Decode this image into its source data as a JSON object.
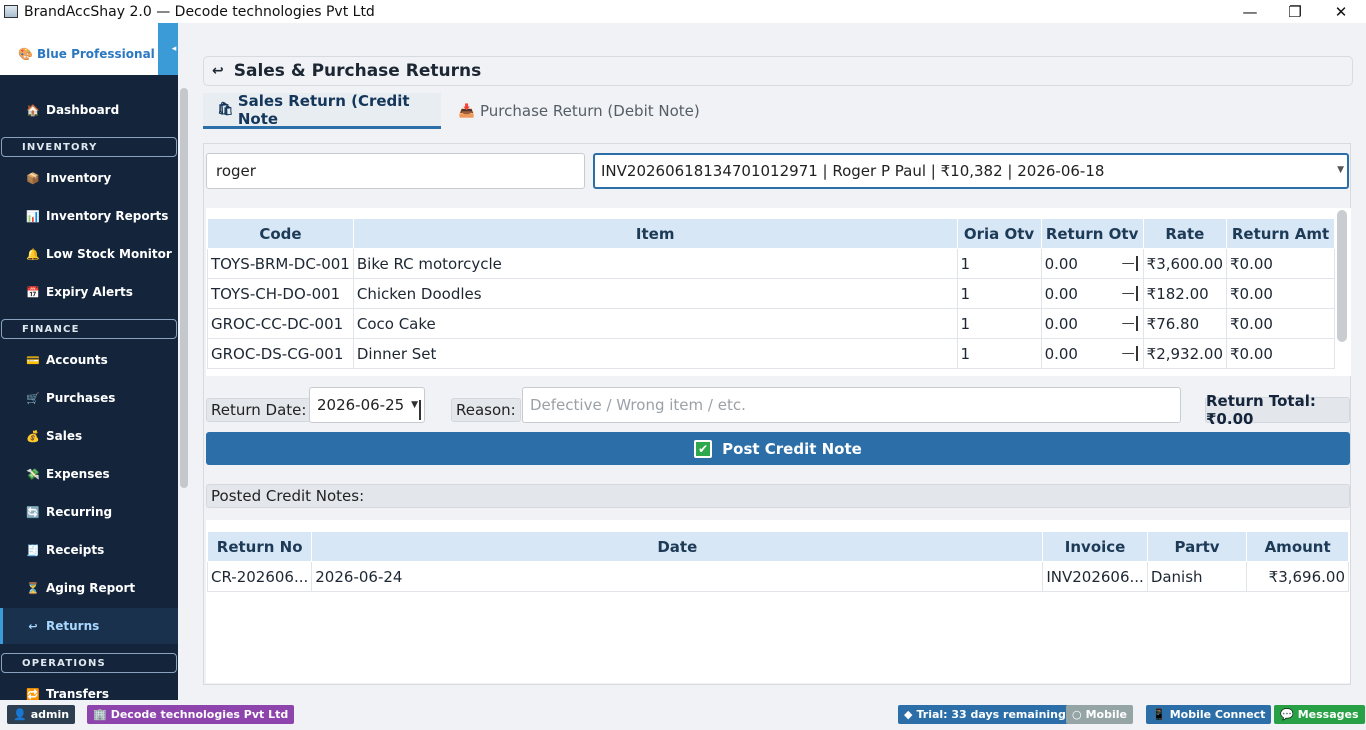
{
  "window": {
    "title": "BrandAccShay 2.0  —  Decode technologies Pvt Ltd",
    "minimize": "—",
    "restore": "❐",
    "close": "✕"
  },
  "sidebar": {
    "brand": "Blue Professional",
    "collapse": "◂",
    "items": [
      {
        "label": "Dashboard",
        "icon": "🏠"
      },
      {
        "section": "INVENTORY"
      },
      {
        "label": "Inventory",
        "icon": "📦"
      },
      {
        "label": "Inventory Reports",
        "icon": "📊"
      },
      {
        "label": "Low Stock Monitor",
        "icon": "🔔"
      },
      {
        "label": "Expiry Alerts",
        "icon": "📅"
      },
      {
        "section": "FINANCE"
      },
      {
        "label": "Accounts",
        "icon": "💳"
      },
      {
        "label": "Purchases",
        "icon": "🛒"
      },
      {
        "label": "Sales",
        "icon": "💰"
      },
      {
        "label": "Expenses",
        "icon": "💸"
      },
      {
        "label": "Recurring",
        "icon": "🔄"
      },
      {
        "label": "Receipts",
        "icon": "🧾"
      },
      {
        "label": "Aging Report",
        "icon": "⏳"
      },
      {
        "label": "Returns",
        "icon": "↩"
      },
      {
        "section": "OPERATIONS"
      },
      {
        "label": "Transfers",
        "icon": "🔁"
      }
    ]
  },
  "header": {
    "title": "Sales & Purchase Returns",
    "icon": "↩"
  },
  "tabs": [
    {
      "label": "Sales Return (Credit Note",
      "active": true
    },
    {
      "label": "Purchase Return (Debit Note)",
      "active": false
    }
  ],
  "search": {
    "value": "roger"
  },
  "invoice_select": {
    "value": "INV20260618134701012971  |  Roger P Paul  |  ₹10,382  |  2026-06-18"
  },
  "items_table": {
    "headers": [
      "Code",
      "Item",
      "Oria Otv",
      "Return Otv",
      "Rate",
      "Return Amt"
    ],
    "rows": [
      {
        "code": "TOYS-BRM-DC-001",
        "item": "Bike RC motorcycle",
        "orig": "1",
        "ret": "0.00",
        "rate": "₹3,600.00",
        "amt": "₹0.00"
      },
      {
        "code": "TOYS-CH-DO-001",
        "item": "Chicken Doodles",
        "orig": "1",
        "ret": "0.00",
        "rate": "₹182.00",
        "amt": "₹0.00"
      },
      {
        "code": "GROC-CC-DC-001",
        "item": "Coco Cake",
        "orig": "1",
        "ret": "0.00",
        "rate": "₹76.80",
        "amt": "₹0.00"
      },
      {
        "code": "GROC-DS-CG-001",
        "item": "Dinner Set",
        "orig": "1",
        "ret": "0.00",
        "rate": "₹2,932.00",
        "amt": "₹0.00"
      }
    ]
  },
  "form": {
    "return_date_label": "Return Date:",
    "return_date": "2026-06-25",
    "reason_label": "Reason:",
    "reason_placeholder": "Defective / Wrong item / etc.",
    "return_total": "Return Total: ₹0.00",
    "post_button": "Post Credit Note"
  },
  "posted": {
    "label": "Posted Credit Notes:",
    "headers": [
      "Return No",
      "Date",
      "Invoice",
      "Partv",
      "Amount"
    ],
    "rows": [
      {
        "no": "CR-202606...",
        "date": "2026-06-24",
        "invoice": "INV202606...",
        "party": "Danish",
        "amount": "₹3,696.00"
      }
    ]
  },
  "statusbar": {
    "user": "admin",
    "company": "Decode technologies Pvt Ltd",
    "trial": "Trial: 33 days remaining",
    "mobile": "Mobile",
    "mobile_connect": "Mobile Connect",
    "messages": "Messages"
  },
  "colors": {
    "sidebar_bg": "#14253b",
    "accent": "#2c6fa8",
    "header_row": "#d7e7f5",
    "success": "#2ea84c",
    "trial_chip": "#2c6fa8",
    "company_chip": "#8e44ad",
    "messages_chip": "#27a046"
  }
}
